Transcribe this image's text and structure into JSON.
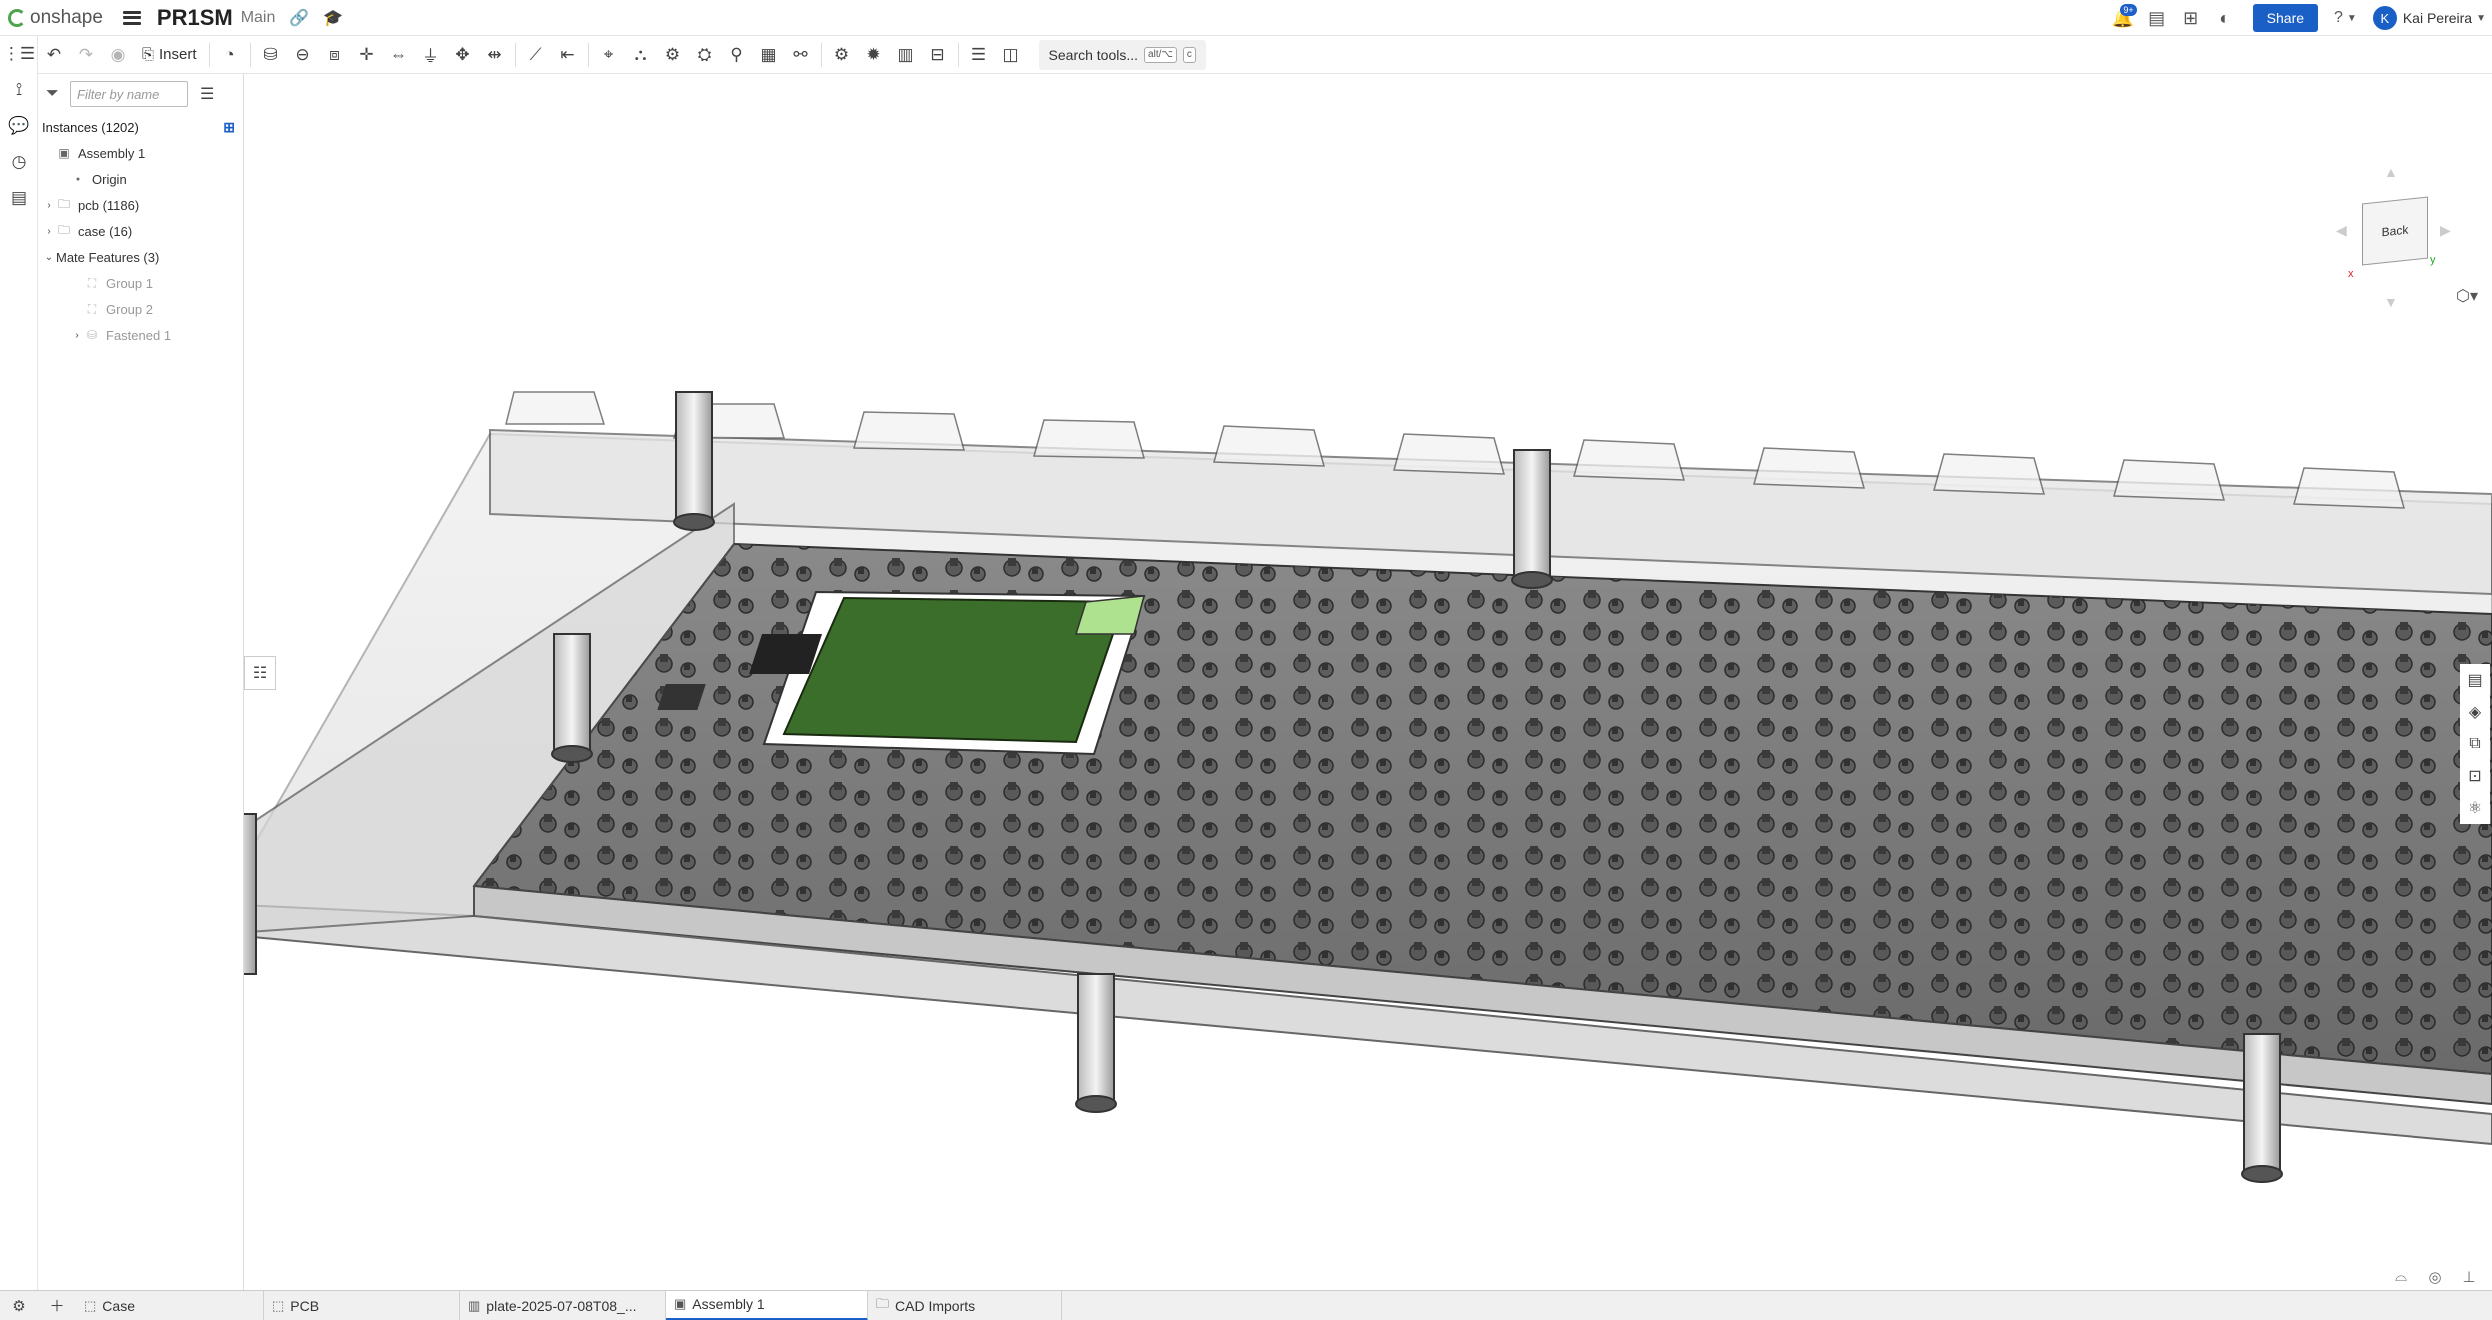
{
  "app": {
    "logo_text": "onshape",
    "doc_title": "PR1SM",
    "branch": "Main"
  },
  "topbar": {
    "notification_count": "9+",
    "share_label": "Share",
    "help_label": "?",
    "user_name": "Kai Pereira",
    "user_initial": "K"
  },
  "toolbar": {
    "insert_label": "Insert",
    "search_label": "Search tools...",
    "search_shortcut_1": "alt/⌥",
    "search_shortcut_2": "c"
  },
  "panel": {
    "filter_placeholder": "Filter by name",
    "instances_label": "Instances (1202)",
    "tree": [
      {
        "label": "Assembly 1",
        "icon": "assembly-icon",
        "indent": 0,
        "expander": "",
        "muted": false
      },
      {
        "label": "Origin",
        "icon": "origin-icon",
        "indent": 1,
        "expander": "",
        "muted": false
      },
      {
        "label": "pcb (1186)",
        "icon": "folder-icon",
        "indent": 0,
        "expander": "›",
        "muted": false
      },
      {
        "label": "case (16)",
        "icon": "folder-icon",
        "indent": 0,
        "expander": "›",
        "muted": false
      },
      {
        "label": "Mate Features (3)",
        "icon": "",
        "indent": 0,
        "expander": "⌄",
        "muted": false
      },
      {
        "label": "Group 1",
        "icon": "group-icon",
        "indent": 2,
        "expander": "",
        "muted": true
      },
      {
        "label": "Group 2",
        "icon": "group-icon",
        "indent": 2,
        "expander": "",
        "muted": true
      },
      {
        "label": "Fastened 1",
        "icon": "fastened-icon",
        "indent": 2,
        "expander": "›",
        "muted": true
      }
    ]
  },
  "viewcube": {
    "face_label": "Back",
    "x_label": "x",
    "y_label": "y"
  },
  "tabs": [
    {
      "label": "Case",
      "icon": "part-studio-icon",
      "active": false
    },
    {
      "label": "PCB",
      "icon": "part-studio-icon",
      "active": false
    },
    {
      "label": "plate-2025-07-08T08_...",
      "icon": "drawing-icon",
      "active": false
    },
    {
      "label": "Assembly 1",
      "icon": "assembly-icon",
      "active": true
    },
    {
      "label": "CAD Imports",
      "icon": "folder-icon",
      "active": false
    }
  ],
  "colors": {
    "accent": "#1a5fc6",
    "pcb_green": "#3b6e2a",
    "plate_gray": "#777777"
  }
}
